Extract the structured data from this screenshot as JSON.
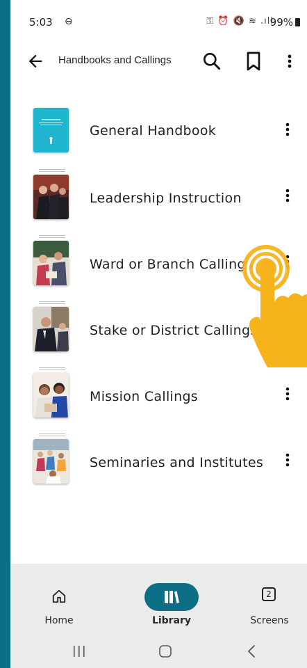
{
  "status_bar": {
    "time": "5:03",
    "dnd_icon": "minus-circle-icon",
    "system_icons": "⚿ ⏰ 🔇 ≋ .ıll",
    "battery": "99%"
  },
  "toolbar": {
    "title": "Handbooks and Callings",
    "back_icon": "arrow-left-icon",
    "search_icon": "search-icon",
    "bookmark_icon": "bookmark-icon",
    "more_icon": "more-vert-icon"
  },
  "items": [
    {
      "label": "General Handbook",
      "thumb": "general-handbook-cover"
    },
    {
      "label": "Leadership Instruction",
      "thumb": "leadership-photo"
    },
    {
      "label": "Ward or Branch Callings",
      "thumb": "ward-callings-photo"
    },
    {
      "label": "Stake or District Callings",
      "thumb": "stake-callings-photo"
    },
    {
      "label": "Mission Callings",
      "thumb": "mission-callings-photo"
    },
    {
      "label": "Seminaries and Institutes",
      "thumb": "seminaries-photo"
    }
  ],
  "bottom_nav": {
    "home": {
      "label": "Home",
      "icon": "home-icon"
    },
    "library": {
      "label": "Library",
      "icon": "library-books-icon",
      "selected": true
    },
    "screens": {
      "label": "Screens",
      "icon": "screens-count-icon",
      "count": "2"
    }
  },
  "colors": {
    "accent": "#0d6f86",
    "nav_bg": "#ebebeb",
    "cover_teal": "#20b5cf",
    "hand": "#f6b21b"
  }
}
